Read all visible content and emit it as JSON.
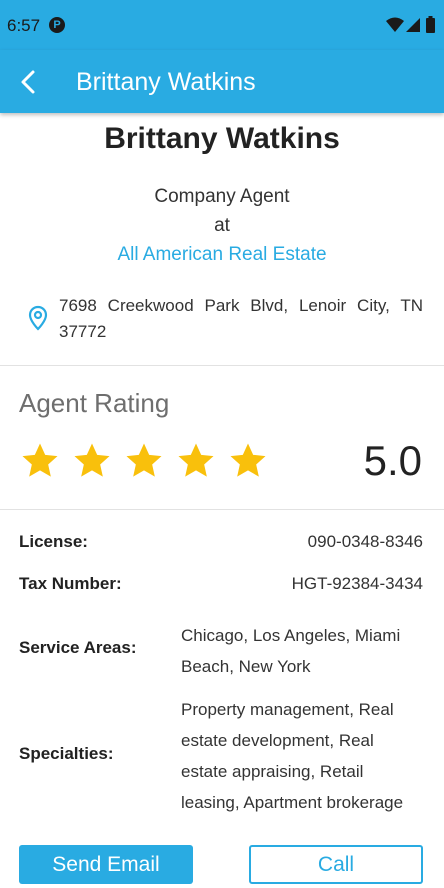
{
  "status_bar": {
    "time": "6:57",
    "notification_glyph": "P",
    "icons": [
      "wifi-icon",
      "signal-icon",
      "battery-icon"
    ]
  },
  "app_bar": {
    "title": "Brittany Watkins",
    "back_icon": "back-arrow-icon"
  },
  "agent": {
    "name": "Brittany Watkins",
    "role": "Company Agent",
    "at": "at",
    "company": "All American Real Estate",
    "address": "7698 Creekwood Park Blvd, Lenoir City, TN 37772"
  },
  "rating": {
    "label": "Agent Rating",
    "stars": 5,
    "max_stars": 5,
    "value": "5.0"
  },
  "details": {
    "license_label": "License:",
    "license_value": "090-0348-8346",
    "tax_label": "Tax Number:",
    "tax_value": "HGT-92384-3434",
    "service_label": "Service Areas:",
    "service_value": "Chicago, Los Angeles, Miami Beach, New York",
    "specialties_label": "Specialties:",
    "specialties_value": "Property management, Real estate development, Real estate appraising, Retail leasing, Apartment brokerage"
  },
  "actions": {
    "email_label": "Send Email",
    "call_label": "Call"
  },
  "colors": {
    "primary": "#29abe2",
    "star": "#f9c00c"
  }
}
